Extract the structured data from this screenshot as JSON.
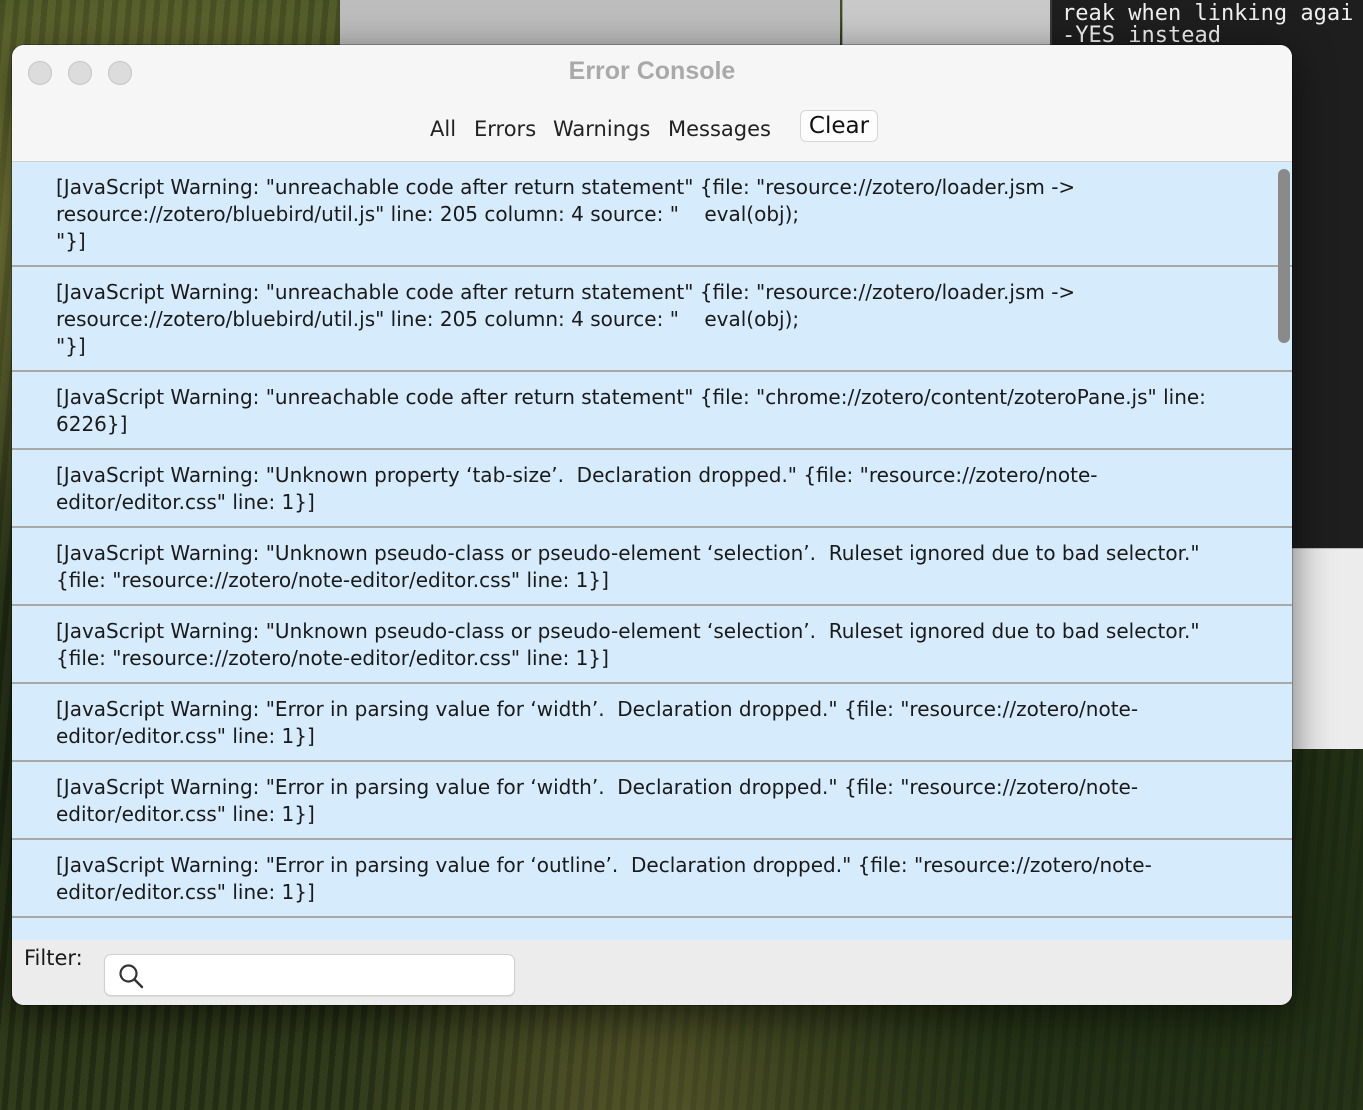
{
  "background": {
    "terminal_lines": [
      "reak when linking agai",
      "-YES instead"
    ]
  },
  "window": {
    "title": "Error Console"
  },
  "toolbar": {
    "all_label": "All",
    "errors_label": "Errors",
    "warnings_label": "Warnings",
    "messages_label": "Messages",
    "clear_label": "Clear"
  },
  "messages": [
    "[JavaScript Warning: \"unreachable code after return statement\" {file: \"resource://zotero/loader.jsm -> resource://zotero/bluebird/util.js\" line: 205 column: 4 source: \"    eval(obj);\n\"}]",
    "[JavaScript Warning: \"unreachable code after return statement\" {file: \"resource://zotero/loader.jsm -> resource://zotero/bluebird/util.js\" line: 205 column: 4 source: \"    eval(obj);\n\"}]",
    "[JavaScript Warning: \"unreachable code after return statement\" {file: \"chrome://zotero/content/zoteroPane.js\" line: 6226}]",
    "[JavaScript Warning: \"Unknown property ‘tab-size’.  Declaration dropped.\" {file: \"resource://zotero/note-editor/editor.css\" line: 1}]",
    "[JavaScript Warning: \"Unknown pseudo-class or pseudo-element ‘selection’.  Ruleset ignored due to bad selector.\" {file: \"resource://zotero/note-editor/editor.css\" line: 1}]",
    "[JavaScript Warning: \"Unknown pseudo-class or pseudo-element ‘selection’.  Ruleset ignored due to bad selector.\" {file: \"resource://zotero/note-editor/editor.css\" line: 1}]",
    "[JavaScript Warning: \"Error in parsing value for ‘width’.  Declaration dropped.\" {file: \"resource://zotero/note-editor/editor.css\" line: 1}]",
    "[JavaScript Warning: \"Error in parsing value for ‘width’.  Declaration dropped.\" {file: \"resource://zotero/note-editor/editor.css\" line: 1}]",
    "[JavaScript Warning: \"Error in parsing value for ‘outline’.  Declaration dropped.\" {file: \"resource://zotero/note-editor/editor.css\" line: 1}]"
  ],
  "filter": {
    "label": "Filter:",
    "value": "",
    "placeholder": ""
  },
  "colors": {
    "message_bg": "#d6ebfb",
    "window_bg": "#ececec",
    "title_text": "#a9a9a9"
  }
}
